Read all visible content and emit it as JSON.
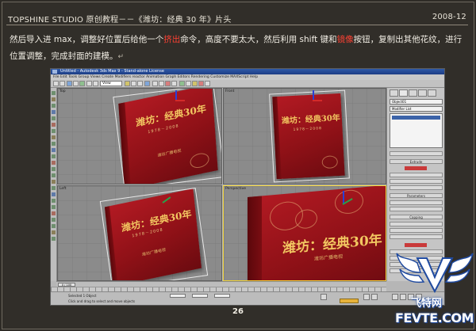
{
  "header": {
    "title": "TOPSHINE STUDIO 原创教程－－《潍坊：经典 30 年》片头",
    "date": "2008-12"
  },
  "paragraph": {
    "part1": "然后导入进 max，调整好位置后给他一个",
    "highlight1": "挤出",
    "part2": "命令，高度不要太大，然后利用 shift 键和",
    "highlight2": "镜像",
    "part3": "按钮，复制出其他花纹，进行位置调整，完成封面的建模。",
    "mark": "↵"
  },
  "screenshot": {
    "window_title": "Untitled - Autodesk 3ds Max 9 - Stand-alone License",
    "menu": "File  Edit  Tools  Group  Views  Create  Modifiers  reactor  Animation  Graph Editors  Rendering  Customize  MAXScript  Help",
    "view_select": "View",
    "object_name": "Object01",
    "viewports": [
      {
        "label": "Top"
      },
      {
        "label": "Front"
      },
      {
        "label": "Left"
      },
      {
        "label": "Perspective"
      }
    ],
    "book": {
      "title": "潍坊：经典",
      "numeral": "30",
      "suffix": "年",
      "years": "1978－2008",
      "subtitle": "潍坊广播电视"
    },
    "panel": {
      "modifier_list": "Modifier List",
      "buttons": [
        "Extrude",
        "Parameters",
        "Capping"
      ]
    },
    "timeline": {
      "frame": "0 / 100"
    },
    "status": {
      "selected": "Selected 1 Object",
      "prompt": "Click and drag to select and move objects"
    }
  },
  "page_number": "26",
  "watermark": {
    "cn": "飞特网",
    "url": "FEVTE.COM"
  },
  "colors": {
    "background": "#2e2b26",
    "highlight": "#ff4133",
    "book_red": "#a3161e",
    "active_viewport": "#f0d33a"
  }
}
